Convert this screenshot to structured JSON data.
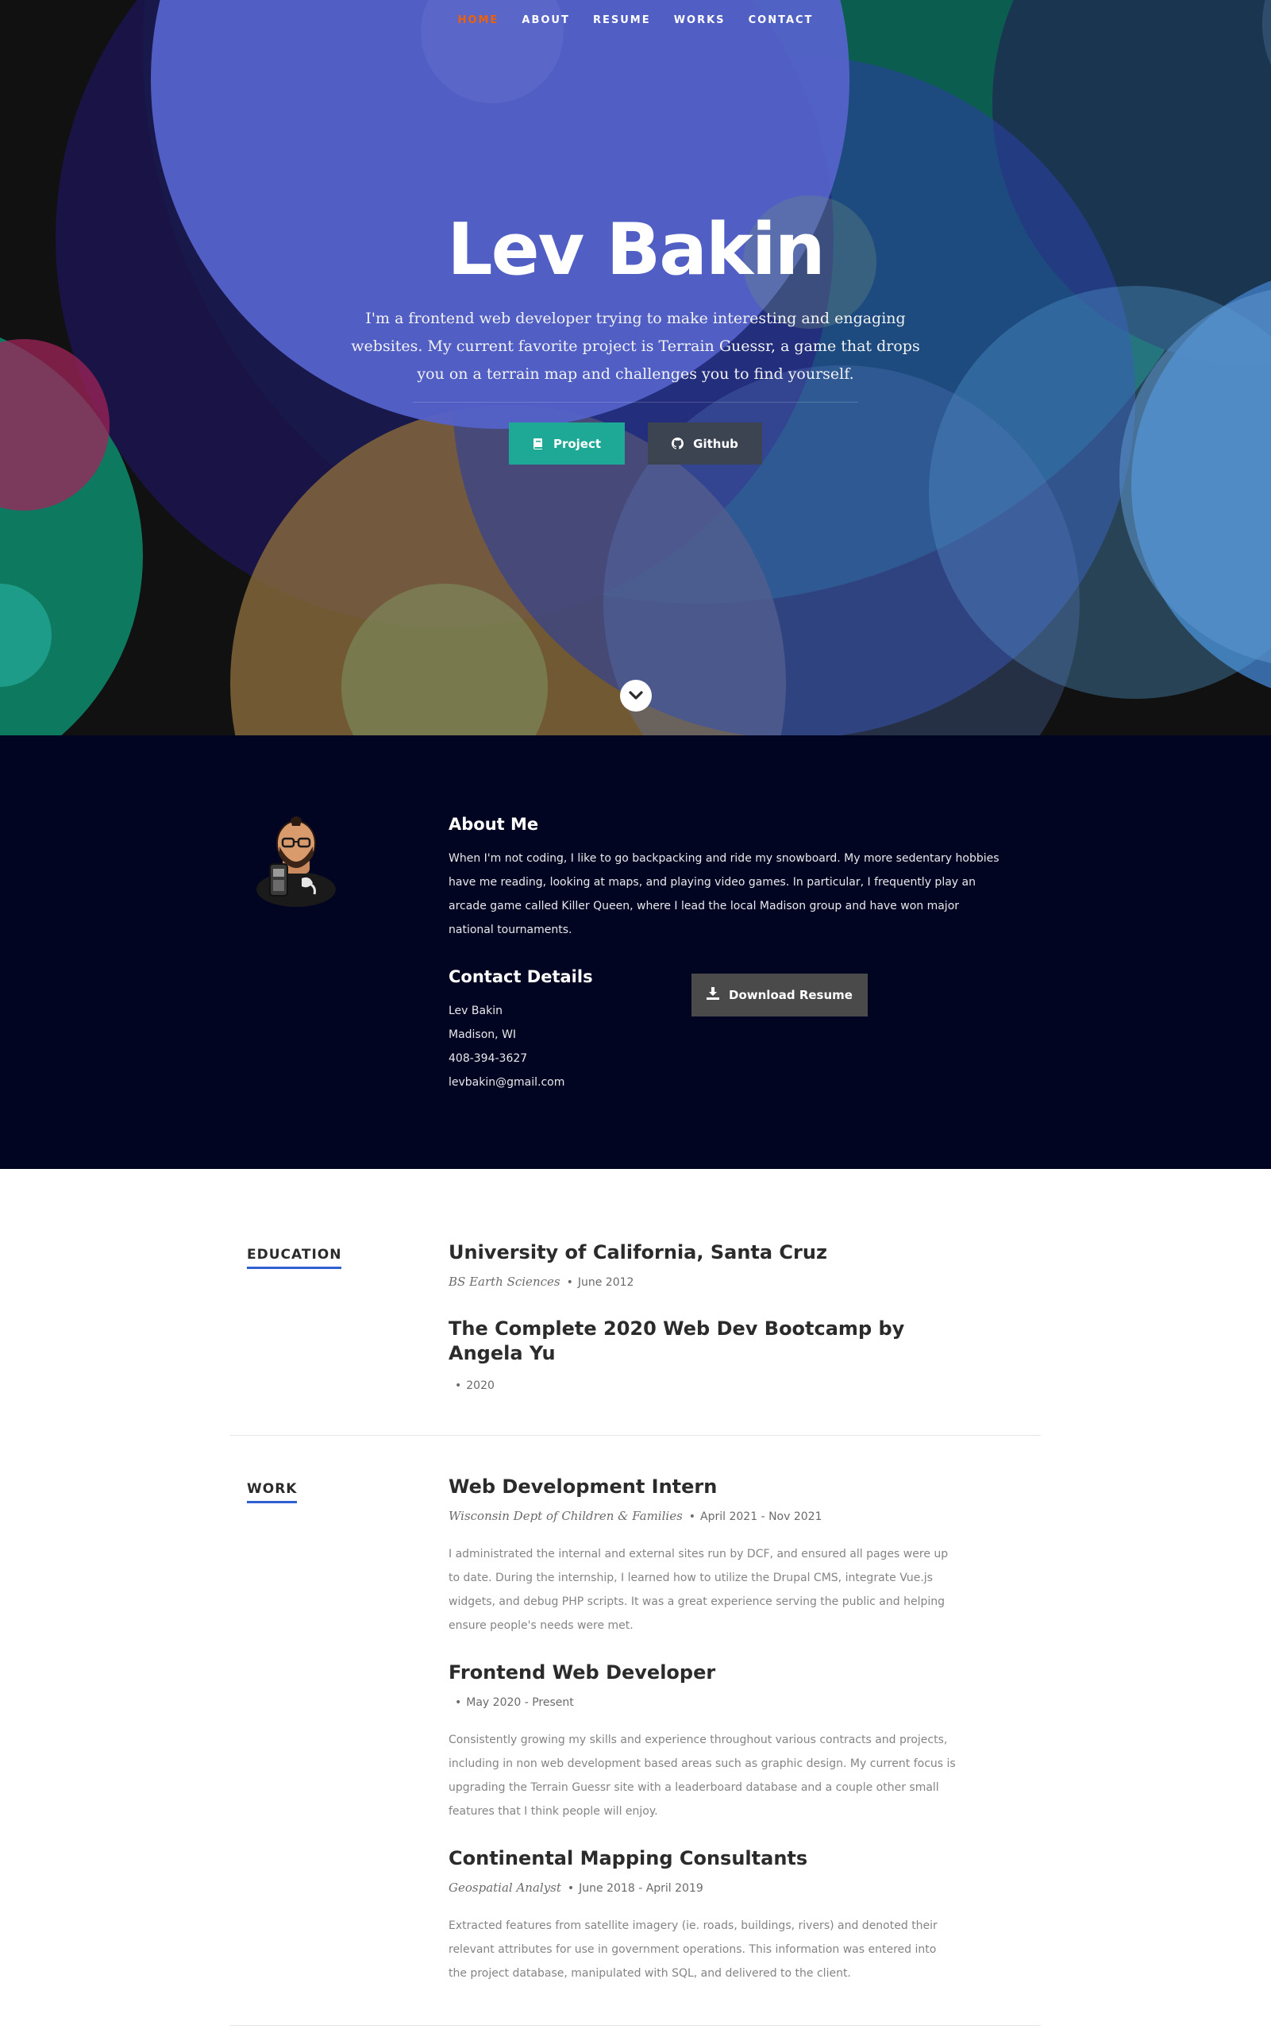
{
  "nav": {
    "items": [
      "HOME",
      "ABOUT",
      "RESUME",
      "WORKS",
      "CONTACT"
    ],
    "active_color": "#f06000"
  },
  "hero": {
    "title": "Lev Bakin",
    "description": "I'm a frontend web developer trying to make interesting and engaging websites. My current favorite project is Terrain Guessr, a game that drops you on a terrain map and challenges you to find yourself.",
    "project_button": "Project",
    "github_button": "Github",
    "project_icon": "book-icon",
    "github_icon": "github-icon",
    "scroll_icon": "chevron-down-icon"
  },
  "about": {
    "heading": "About Me",
    "text": "When I'm not coding, I like to go backpacking and ride my snowboard. My more sedentary hobbies have me reading, looking at maps, and playing video games. In particular, I frequently play an arcade game called Killer Queen, where I lead the local Madison group and have won major national tournaments.",
    "contact_heading": "Contact Details",
    "contact": [
      "Lev Bakin",
      "Madison, WI",
      "408-394-3627",
      "levbakin@gmail.com"
    ],
    "download_button": "Download Resume",
    "download_icon": "download-icon"
  },
  "resume": {
    "education_label": "EDUCATION",
    "education": [
      {
        "title": "University of California, Santa Cruz",
        "role": "BS Earth Sciences",
        "date": "June 2012"
      },
      {
        "title": "The Complete 2020 Web Dev Bootcamp by Angela Yu",
        "role": "",
        "date": "2020"
      }
    ],
    "work_label": "WORK",
    "work": [
      {
        "title": "Web Development Intern",
        "role": "Wisconsin Dept of Children & Families",
        "date": "April 2021 - Nov 2021",
        "description": "I administrated the internal and external sites run by DCF, and ensured all pages were up to date. During the internship, I learned how to utilize the Drupal CMS, integrate Vue.js widgets, and debug PHP scripts. It was a great experience serving the public and helping ensure people's needs were met."
      },
      {
        "title": "Frontend Web Developer",
        "role": "",
        "date": "May 2020 - Present",
        "description": "Consistently growing my skills and experience throughout various contracts and projects, including in non web development based areas such as graphic design. My current focus is upgrading the Terrain Guessr site with a leaderboard database and a couple other small features that I think people will enjoy."
      },
      {
        "title": "Continental Mapping Consultants",
        "role": "Geospatial Analyst",
        "date": "June 2018 - April 2019",
        "description": "Extracted features from satellite imagery (ie. roads, buildings, rivers) and denoted their relevant attributes for use in government operations. This information was entered into the project database, manipulated with SQL, and delivered to the client."
      }
    ],
    "accent_color": "#2f5fd0"
  }
}
